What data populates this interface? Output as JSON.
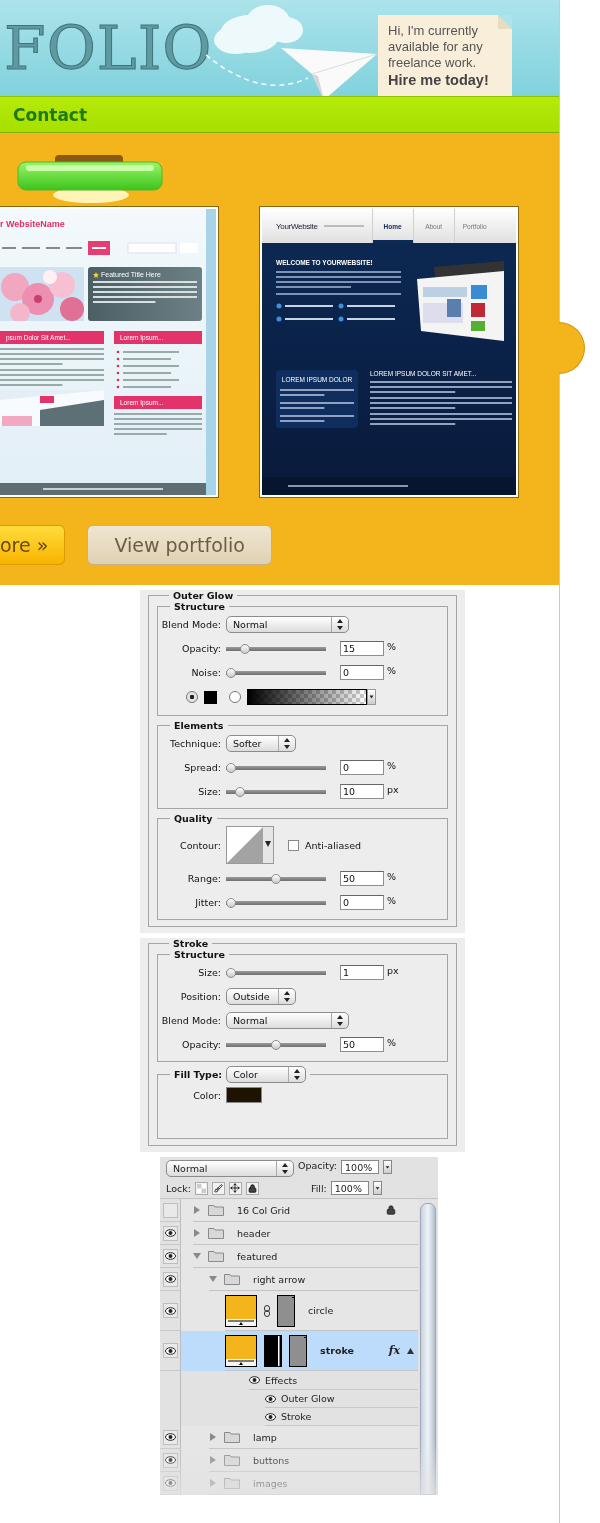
{
  "header": {
    "logo": "FOLIO",
    "note": "Hi, I'm currently available for any freelance work. **Hire me today!**"
  },
  "nav": {
    "items": [
      {
        "label": "Contact"
      }
    ]
  },
  "featured": {
    "thumbnails": [
      {
        "kind": "light",
        "site_name": "r WebsiteName",
        "feature_title": "Featured Title Here",
        "section_titles": [
          "psum Dolor Sit Amet...",
          "Lorem Ipsum...",
          "Lorem Ipsum..."
        ]
      },
      {
        "kind": "dark",
        "site_name": "YourWebsite",
        "nav": [
          {
            "label": "Home",
            "selected": true
          },
          {
            "label": "About",
            "selected": false
          },
          {
            "label": "Portfolio",
            "selected": false
          }
        ],
        "welcome": "WELCOME TO YOURWEBSITE!",
        "box_title": "LOREM IPSUM DOLOR",
        "section_title": "LOREM IPSUM DOLOR SIT AMET..."
      }
    ],
    "buttons": [
      {
        "label": "ore »",
        "kind": "primary"
      },
      {
        "label": "View portfolio",
        "kind": "secondary"
      }
    ]
  },
  "outer_glow": {
    "title": "Outer Glow",
    "groups": [
      {
        "title": "Structure",
        "rows": [
          {
            "kind": "select",
            "label": "Blend Mode:",
            "value": "Normal"
          },
          {
            "kind": "slider",
            "label": "Opacity:",
            "level": 0.15,
            "value": "15",
            "unit": "%"
          },
          {
            "kind": "slider",
            "label": "Noise:",
            "level": 0,
            "value": "0",
            "unit": "%"
          },
          {
            "kind": "fill",
            "options": [
              {
                "kind": "color",
                "selected": true
              },
              {
                "kind": "gradient",
                "selected": false
              }
            ]
          }
        ]
      },
      {
        "title": "Elements",
        "rows": [
          {
            "kind": "short-select",
            "label": "Technique:",
            "value": "Softer"
          },
          {
            "kind": "slider",
            "label": "Spread:",
            "level": 0,
            "value": "0",
            "unit": "%"
          },
          {
            "kind": "slider",
            "label": "Size:",
            "level": 0.1,
            "value": "10",
            "unit": "px"
          }
        ]
      },
      {
        "title": "Quality",
        "rows": [
          {
            "kind": "contour",
            "label": "Contour:",
            "checkbox": {
              "label": "Anti-aliased",
              "checked": false
            }
          },
          {
            "kind": "slider",
            "label": "Range:",
            "level": 0.5,
            "value": "50",
            "unit": "%"
          },
          {
            "kind": "slider",
            "label": "Jitter:",
            "level": 0,
            "value": "0",
            "unit": "%"
          }
        ]
      }
    ]
  },
  "stroke": {
    "title": "Stroke",
    "groups": [
      {
        "title": "Structure",
        "rows": [
          {
            "kind": "slider",
            "label": "Size:",
            "level": 0,
            "value": "1",
            "unit": "px"
          },
          {
            "kind": "short-select",
            "label": "Position:",
            "value": "Outside"
          },
          {
            "kind": "select",
            "label": "Blend Mode:",
            "value": "Normal"
          },
          {
            "kind": "slider",
            "label": "Opacity:",
            "level": 0.5,
            "value": "50",
            "unit": "%"
          }
        ]
      },
      {
        "title": "Fill Type:",
        "select": "Color",
        "rows": [
          {
            "kind": "swatch",
            "label": "Color:",
            "color": "#1e1300"
          }
        ]
      }
    ]
  },
  "layers": {
    "blend_mode": "Normal",
    "opacity_label": "Opacity:",
    "opacity": "100%",
    "lock_label": "Lock:",
    "fill_label": "Fill:",
    "fill": "100%",
    "items": [
      {
        "kind": "group",
        "name": "16 Col Grid",
        "visible": false,
        "expanded": false,
        "locked": true,
        "selected": false
      },
      {
        "kind": "group",
        "name": "header",
        "visible": true,
        "expanded": false,
        "locked": false,
        "selected": false
      },
      {
        "kind": "group",
        "name": "featured",
        "visible": true,
        "expanded": true,
        "locked": false,
        "selected": false,
        "children": [
          {
            "kind": "group",
            "name": "right arrow",
            "visible": true,
            "expanded": true,
            "locked": false,
            "selected": false,
            "children": [
              {
                "kind": "layer",
                "name": "circle",
                "visible": true,
                "selected": false,
                "linked": true,
                "vector_mask": false
              },
              {
                "kind": "layer",
                "name": "stroke",
                "visible": true,
                "selected": true,
                "linked": false,
                "vector_mask": true,
                "fx": "fx",
                "effects": {
                  "label": "Effects",
                  "visible": true,
                  "items": [
                    {
                      "label": "Outer Glow",
                      "visible": true
                    },
                    {
                      "label": "Stroke",
                      "visible": true
                    }
                  ]
                }
              }
            ]
          },
          {
            "kind": "group",
            "name": "lamp",
            "visible": true,
            "expanded": false,
            "locked": false,
            "selected": false
          },
          {
            "kind": "group",
            "name": "buttons",
            "visible": true,
            "expanded": false,
            "locked": false,
            "selected": false
          },
          {
            "kind": "group",
            "name": "images",
            "visible": true,
            "expanded": false,
            "locked": false,
            "selected": false
          }
        ]
      }
    ]
  }
}
